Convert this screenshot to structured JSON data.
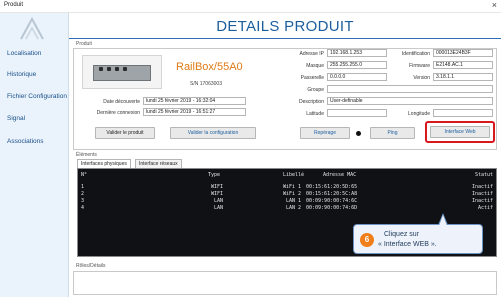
{
  "window": {
    "title": "Produit",
    "close": "×"
  },
  "sidebar": {
    "items": [
      {
        "label": "Localisation"
      },
      {
        "label": "Historique"
      },
      {
        "label": "Fichier Configuration"
      },
      {
        "label": "Signal"
      },
      {
        "label": "Associations"
      }
    ]
  },
  "header": {
    "title": "DETAILS PRODUIT"
  },
  "produit": {
    "section_label": "Produit",
    "name": "RailBox/55A0",
    "serial": "S/N 17063003",
    "date_decouverte_label": "Date découverte",
    "date_decouverte": "lundi 25 février 2019 - 16:32:04",
    "derniere_connexion_label": "Dernière connexion",
    "derniere_connexion": "lundi 25 février 2019 - 16:51:27"
  },
  "network": {
    "ip_label": "Adresse IP",
    "ip": "192.168.1.253",
    "mask_label": "Masque",
    "mask": "255.255.255.0",
    "gateway_label": "Passerelle",
    "gateway": "0.0.0.0",
    "group_label": "Groupe",
    "group": "",
    "description_label": "Description",
    "description": "User-definable",
    "latitude_label": "Latitude",
    "latitude": "",
    "longitude_label": "Longitude",
    "longitude": ""
  },
  "identity": {
    "identification_label": "Identification",
    "identification": "000013E24B3F",
    "firmware_label": "Firmware",
    "firmware": "E2148.AC.1",
    "version_label": "Version",
    "version": "3.18.1.1"
  },
  "buttons": {
    "valider_produit": "Valider le produit",
    "valider_config": "Valider la configuration",
    "reperage": "Repérage",
    "ping": "Ping",
    "interface_web": "Interface Web"
  },
  "elements": {
    "section_label": "Éléments",
    "tabs": [
      "Interfaces physiques",
      "Interface réseaux"
    ],
    "columns": [
      "N°",
      "Type",
      "Libellé",
      "Adresse MAC",
      "Statut"
    ],
    "rows": [
      [
        "1",
        "WIFI",
        "WiFi 1",
        "00:15:61:20:5D:65",
        "Inactif"
      ],
      [
        "2",
        "WIFI",
        "WiFi 2",
        "00:15:61:20:5C:A8",
        "Inactif"
      ],
      [
        "3",
        "LAN",
        "LAN 1",
        "00:09:90:00:74:6C",
        "Inactif"
      ],
      [
        "4",
        "LAN",
        "LAN 2",
        "00:09:90:00:74:6D",
        "Actif"
      ]
    ]
  },
  "callout": {
    "number": "6",
    "line1": "Cliquez sur",
    "line2": "« Interface WEB »."
  },
  "roles": {
    "section_label": "Rôles/Détails"
  },
  "colors": {
    "accent": "#1b5e9e",
    "product_name": "#e07a17",
    "highlight": "#d9171c",
    "callout_badge": "#f07e1a"
  }
}
